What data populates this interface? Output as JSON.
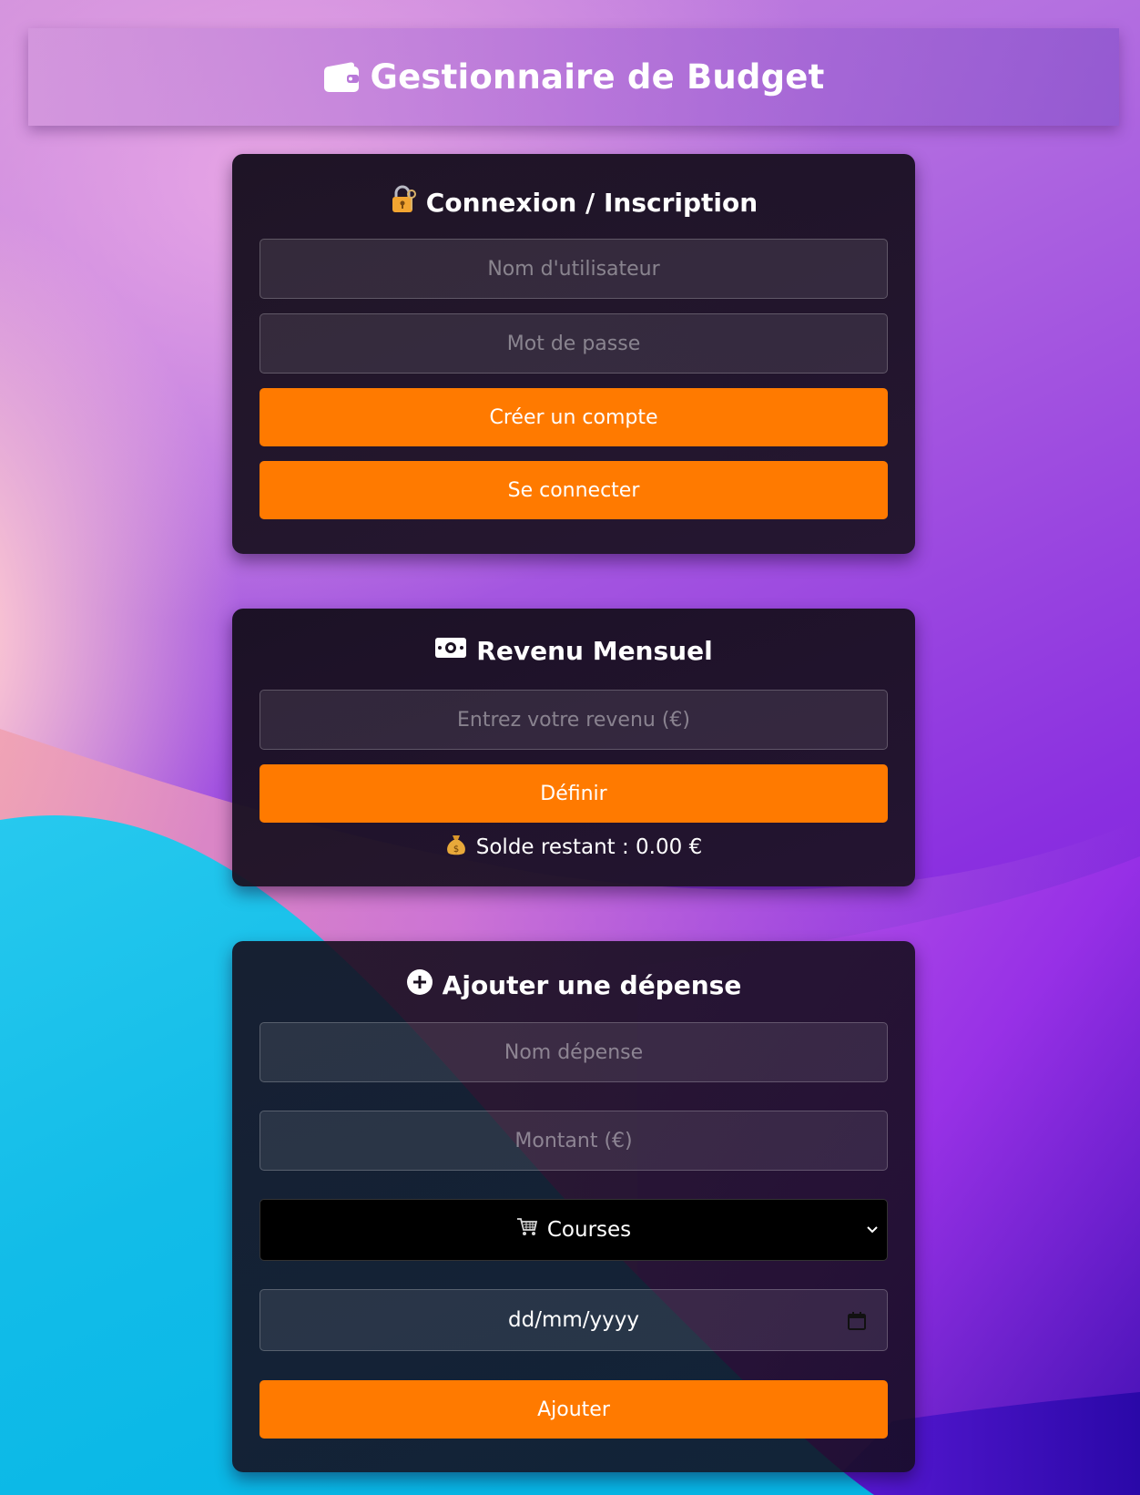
{
  "header": {
    "title": "Gestionnaire de Budget",
    "icon": "wallet-icon"
  },
  "auth": {
    "title": "Connexion / Inscription",
    "icon": "lock-key-icon",
    "username_placeholder": "Nom d'utilisateur",
    "password_placeholder": "Mot de passe",
    "create_label": "Créer un compte",
    "login_label": "Se connecter"
  },
  "income": {
    "title": "Revenu Mensuel",
    "icon": "banknote-icon",
    "input_placeholder": "Entrez votre revenu (€)",
    "set_label": "Définir",
    "balance_icon": "money-bag-icon",
    "balance_text": "Solde restant : 0.00 €"
  },
  "expense": {
    "title": "Ajouter une dépense",
    "icon": "plus-circle-icon",
    "name_placeholder": "Nom dépense",
    "amount_placeholder": "Montant (€)",
    "category_selected": "Courses",
    "category_icon": "shopping-cart-icon",
    "date_placeholder": "dd/mm/yyyy",
    "add_label": "Ajouter"
  },
  "colors": {
    "accent": "#ff7a00",
    "card_bg": "#1a1020",
    "text": "#ffffff"
  }
}
